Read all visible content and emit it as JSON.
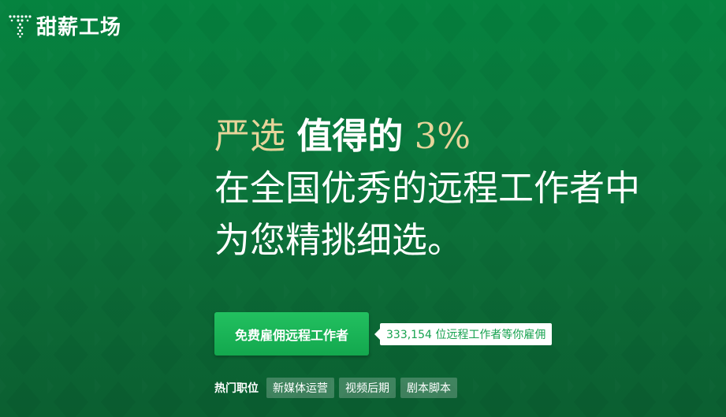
{
  "brand": {
    "name": "甜薪工场",
    "logo_icon": "dotted-t-logo-icon"
  },
  "hero": {
    "headline_gold_1": "严选",
    "headline_strong": "值得的",
    "headline_gold_2": "3%",
    "headline_line2": "在全国优秀的远程工作者中",
    "headline_line3": "为您精挑细选。"
  },
  "cta": {
    "button_label": "免费雇佣远程工作者",
    "count_badge": "333,154 位远程工作者等你雇佣"
  },
  "hot_jobs": {
    "label": "热门职位",
    "tags": [
      "新媒体运营",
      "视频后期",
      "剧本脚本"
    ]
  },
  "colors": {
    "background": "#0a7a3e",
    "accent_gold": "#e6d49a",
    "cta_green": "#1bb457",
    "badge_text": "#16a24f"
  }
}
